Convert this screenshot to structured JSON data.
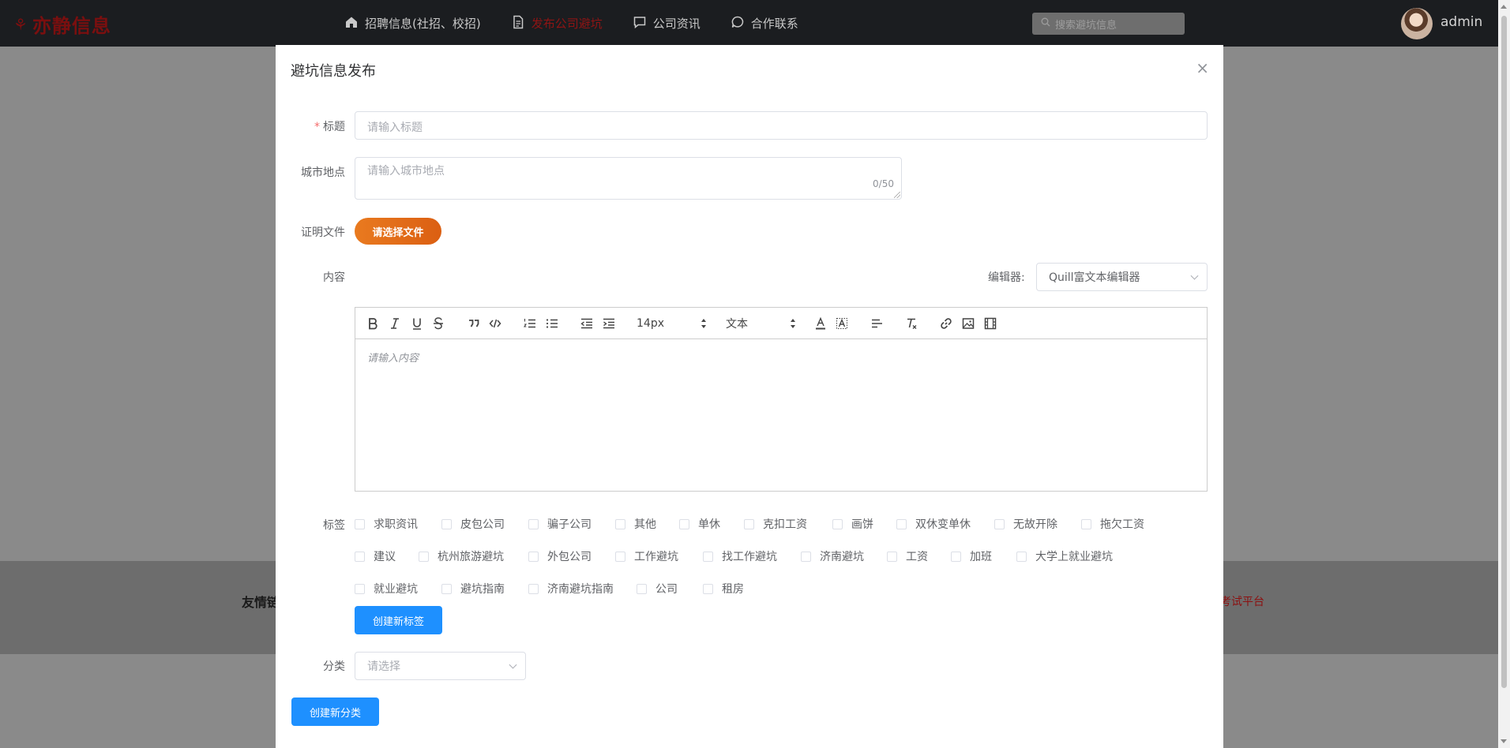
{
  "brand": {
    "name": "亦静信息"
  },
  "nav": {
    "items": [
      {
        "label": "招聘信息(社招、校招)",
        "icon": "home-icon"
      },
      {
        "label": "发布公司避坑",
        "icon": "document-icon"
      },
      {
        "label": "公司资讯",
        "icon": "chat-square-icon"
      },
      {
        "label": "合作联系",
        "icon": "chat-round-icon"
      }
    ]
  },
  "search": {
    "placeholder": "搜索避坑信息"
  },
  "user": {
    "name": "admin"
  },
  "background": {
    "footer_left": "友情链",
    "footer_right": "考试平台"
  },
  "dialog": {
    "title": "避坑信息发布",
    "close": "×",
    "form": {
      "title_label": "标题",
      "title_required_mark": "*",
      "title_placeholder": "请输入标题",
      "city_label": "城市地点",
      "city_placeholder": "请输入城市地点",
      "city_counter": "0/50",
      "file_label": "证明文件",
      "file_button": "请选择文件",
      "content_label": "内容",
      "editor_label": "编辑器:",
      "editor_value": "Quill富文本编辑器",
      "toolbar": {
        "size": "14px",
        "header": "文本",
        "icons": [
          "bold-icon",
          "italic-icon",
          "underline-icon",
          "strike-icon",
          "quote-icon",
          "code-icon",
          "ordered-list-icon",
          "bullet-list-icon",
          "outdent-icon",
          "indent-icon",
          "font-color-icon",
          "background-color-icon",
          "align-icon",
          "clear-format-icon",
          "link-icon",
          "image-icon",
          "video-icon"
        ]
      },
      "content_placeholder": "请输入内容",
      "tags_label": "标签",
      "tags": [
        "求职资讯",
        "皮包公司",
        "骗子公司",
        "其他",
        "单休",
        "克扣工资",
        "画饼",
        "双休变单休",
        "无故开除",
        "拖欠工资",
        "建议",
        "杭州旅游避坑",
        "外包公司",
        "工作避坑",
        "找工作避坑",
        "济南避坑",
        "工资",
        "加班",
        "大学上就业避坑",
        "就业避坑",
        "避坑指南",
        "济南避坑指南",
        "公司",
        "租房"
      ],
      "new_tag_button": "创建新标签",
      "category_label": "分类",
      "category_placeholder": "请选择",
      "new_category_button": "创建新分类"
    }
  }
}
